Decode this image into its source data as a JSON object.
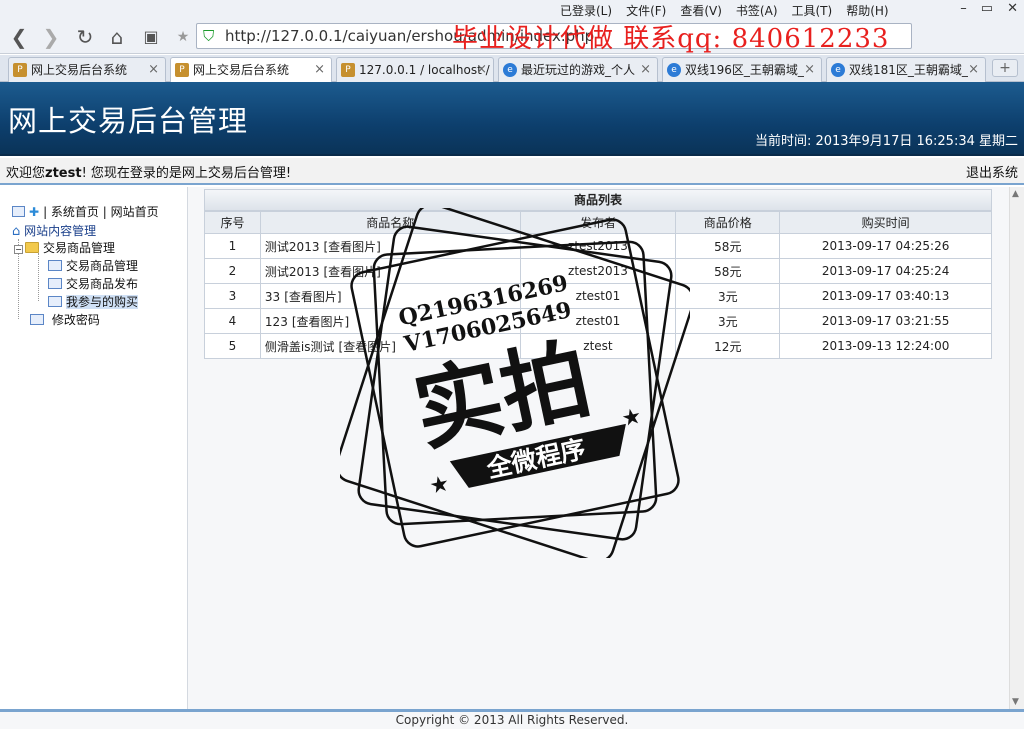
{
  "browser": {
    "menus": [
      "已登录(L)",
      "文件(F)",
      "查看(V)",
      "书签(A)",
      "工具(T)",
      "帮助(H)"
    ],
    "url": "http://127.0.0.1/caiyuan/ershou/admin/index.php",
    "overlay_text": "毕业设计代做 联系qq: 840612233",
    "tabs": [
      {
        "label": "网上交易后台系统",
        "icon": "pma-icon"
      },
      {
        "label": "网上交易后台系统",
        "icon": "pma-icon"
      },
      {
        "label": "127.0.0.1 / localhost /",
        "icon": "pma-icon"
      },
      {
        "label": "最近玩过的游戏_个人",
        "icon": "ie-icon"
      },
      {
        "label": "双线196区_王朝霸域_",
        "icon": "ie-icon"
      },
      {
        "label": "双线181区_王朝霸域_",
        "icon": "ie-icon"
      }
    ],
    "active_tab": 1
  },
  "header": {
    "title": "网上交易后台管理",
    "time_label": "当前时间: 2013年9月17日 16:25:34 星期二"
  },
  "welcome": {
    "prefix": "欢迎您",
    "user": "ztest",
    "suffix": "! 您现在登录的是网上交易后台管理!",
    "logout": "退出系统"
  },
  "sidebar": {
    "top_links": "| 系统首页 | 网站首页",
    "root": "网站内容管理",
    "group": "交易商品管理",
    "items": [
      "交易商品管理",
      "交易商品发布",
      "我参与的购买"
    ],
    "password": "修改密码",
    "selected": 2
  },
  "list": {
    "title": "商品列表",
    "columns": [
      "序号",
      "商品名称",
      "发布者",
      "商品价格",
      "购买时间"
    ],
    "view_label": "[查看图片]",
    "rows": [
      {
        "no": "1",
        "name": "测试2013",
        "publisher": "ztest2013",
        "price": "58元",
        "time": "2013-09-17 04:25:26"
      },
      {
        "no": "2",
        "name": "测试2013",
        "publisher": "ztest2013",
        "price": "58元",
        "time": "2013-09-17 04:25:24"
      },
      {
        "no": "3",
        "name": "33",
        "publisher": "ztest01",
        "price": "3元",
        "time": "2013-09-17 03:40:13"
      },
      {
        "no": "4",
        "name": "123",
        "publisher": "ztest01",
        "price": "3元",
        "time": "2013-09-17 03:21:55"
      },
      {
        "no": "5",
        "name": "侧滑盖is测试",
        "publisher": "ztest",
        "price": "12元",
        "time": "2013-09-13 12:24:00"
      }
    ]
  },
  "stamp": {
    "line1": "Q2196316269",
    "line2": "V1706025649",
    "main": "实拍",
    "banner": "全微程序"
  },
  "footer": "Copyright © 2013 All Rights Reserved."
}
